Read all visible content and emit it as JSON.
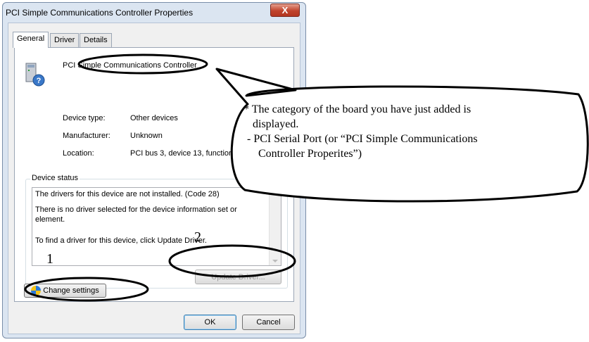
{
  "window": {
    "title": "PCI Simple Communications Controller Properties",
    "close_label": "X"
  },
  "tabs": [
    {
      "label": "General",
      "active": true
    },
    {
      "label": "Driver",
      "active": false
    },
    {
      "label": "Details",
      "active": false
    }
  ],
  "device": {
    "name": "PCI Simple Communications Controller",
    "icon": "unknown-device-icon",
    "properties": [
      {
        "label": "Device type:",
        "value": "Other devices"
      },
      {
        "label": "Manufacturer:",
        "value": "Unknown"
      },
      {
        "label": "Location:",
        "value": "PCI bus 3, device 13, function"
      }
    ]
  },
  "status": {
    "legend": "Device status",
    "line1": "The drivers for this device are not installed. (Code 28)",
    "line2": "There is no driver selected for the device information set or element.",
    "line3": "To find a driver for this device, click Update Driver."
  },
  "buttons": {
    "update_driver": "Update Driver...",
    "change_settings": "Change settings",
    "ok": "OK",
    "cancel": "Cancel"
  },
  "annotations": {
    "label_1": "1",
    "label_2": "2",
    "callout_line1": "* The category of the board you have just added is",
    "callout_line2": "displayed.",
    "callout_line3": "- PCI Serial Port (or “PCI Simple Communications",
    "callout_line4": "Controller Properites”)"
  }
}
